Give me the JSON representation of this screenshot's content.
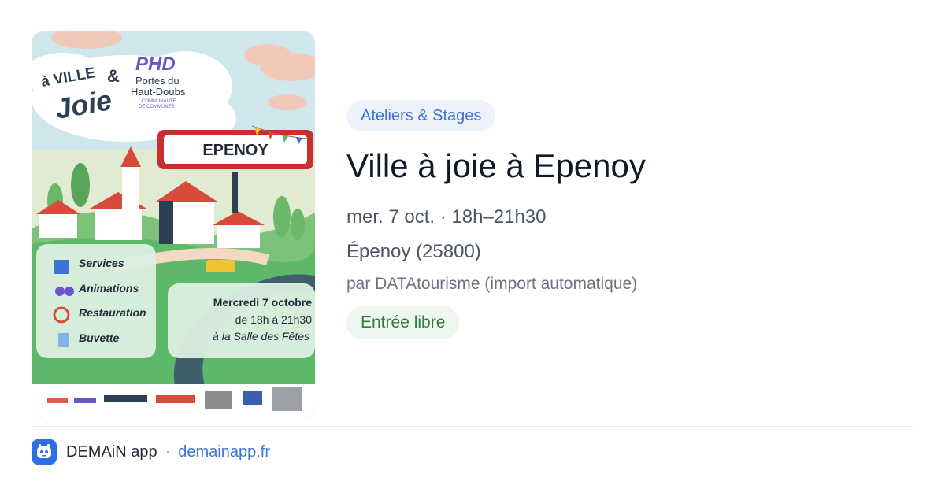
{
  "poster": {
    "headline_line1": "à VILLE",
    "headline_amp": "&",
    "headline_line2": "Joie",
    "brand_logo": "PHD",
    "brand_name_1": "Portes du",
    "brand_name_2": "Haut-Doubs",
    "brand_sub_1": "COMMUNAUTÉ",
    "brand_sub_2": "DE COMMUNES",
    "sign_text": "EPENOY",
    "services": [
      "Services",
      "Animations",
      "Restauration",
      "Buvette"
    ],
    "date_line1": "Mercredi 7 octobre",
    "date_line2": "de 18h à 21h30",
    "date_line3": "à la Salle des Fêtes",
    "sponsors": [
      "mutualité",
      "agir-asso",
      "AGIR LA MONDIALE",
      "TERRITOIRES",
      "PRÉFET DE LA RÉGION BOURGOGNE-FRANCHE-COMTÉ",
      "RÉPUBLIQUE FRANÇAISE",
      "MINISTÈRE DE LA TRANSITION ÉCOLOGIQUE"
    ]
  },
  "event": {
    "category": "Ateliers & Stages",
    "title": "Ville à joie à Epenoy",
    "datetime": "mer. 7 oct. · 18h–21h30",
    "location": "Épenoy (25800)",
    "source": "par DATAtourisme (import automatique)",
    "price": "Entrée libre"
  },
  "footer": {
    "app_name": "DEMAiN app",
    "separator": "·",
    "link": "demainapp.fr"
  },
  "colors": {
    "accent": "#3b73d6",
    "free_green": "#2e7d3c",
    "poster_green": "#5db86a",
    "sign_red": "#c8302d"
  }
}
